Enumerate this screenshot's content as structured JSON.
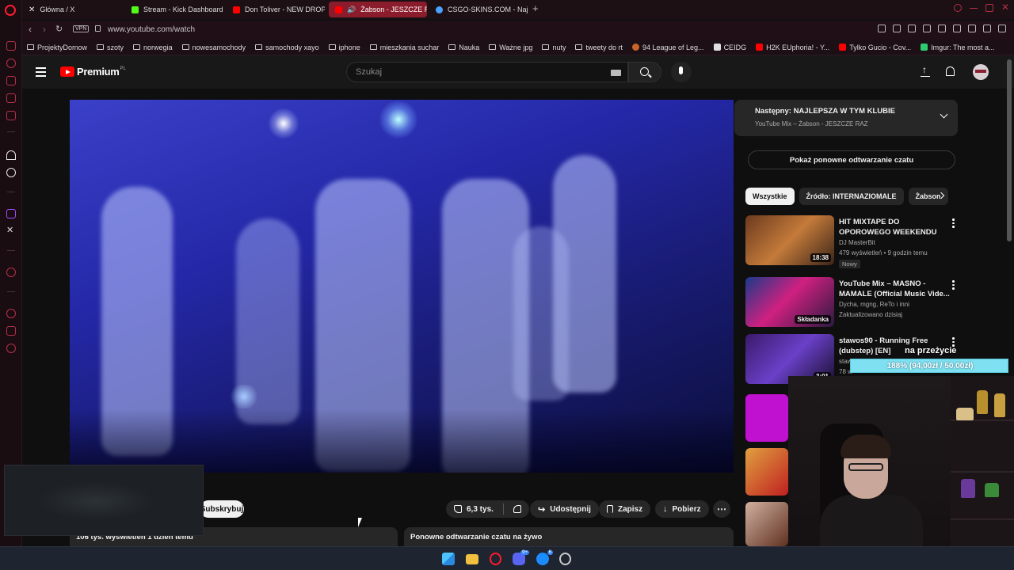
{
  "browser": {
    "tabs": [
      {
        "label": "Główna / X",
        "color": "#e7e7e7"
      },
      {
        "label": "Stream - Kick Dashboard",
        "color": "#53fc18"
      },
      {
        "label": "Don Toliver - NEW DROP",
        "color": "#ff0000"
      },
      {
        "label": "Żabson - JESZCZE RA",
        "color": "#ff0000"
      },
      {
        "label": "CSGO-SKINS.COM - Naj",
        "color": "#4aa3ff"
      }
    ],
    "url": "www.youtube.com/watch",
    "vpn": "VPN",
    "bookmarks": [
      "ProjektyDomow",
      "szoty",
      "norwegia",
      "nowesamochody",
      "samochody xayo",
      "iphone",
      "mieszkania suchar",
      "Nauka",
      "Ważne jpg",
      "nuty",
      "tweety do rt",
      "94 League of Leg...",
      "CEIDG",
      "H2K EUphoria! - Y...",
      "Tylko Gucio - Cov...",
      "Imgur: The most a..."
    ]
  },
  "youtube": {
    "brand": "Premium",
    "region": "PL",
    "search_placeholder": "Szukaj",
    "next": {
      "title": "Następny: NAJLEPSZA W TYM KLUBIE",
      "subtitle": "YouTube Mix – Żabson - JESZCZE RAZ"
    },
    "replay_chat": "Pokaż ponowne odtwarzanie czatu",
    "chips": [
      "Wszystkie",
      "Źródło: INTERNAZIOMALE",
      "Żabson"
    ],
    "recommendations": [
      {
        "title": "HIT MIXTAPE DO OPOROWEGO WEEKENDU",
        "channel": "DJ MasterBit",
        "meta": "479 wyświetleń • 9 godzin temu",
        "badge": "Nowy",
        "duration": "18:38"
      },
      {
        "title": "YouTube Mix – MASNO - MAMALE (Official Music Vide...",
        "channel": "Dycha, mgng, ReTo i inni",
        "meta": "Zaktualizowano dzisiaj",
        "badge": "",
        "duration": "Składanka"
      },
      {
        "title": "stawos90 - Running Free (dubstep) [EN]",
        "channel": "stawos90",
        "meta": "78 w",
        "badge": "",
        "duration": "3:01"
      }
    ],
    "actions": {
      "subscribe": "Subskrybuj",
      "likes": "6,3 tys.",
      "share": "Udostępnij",
      "save": "Zapisz",
      "download": "Pobierz"
    },
    "description": "106 tys. wyświetleń  1 dzień temu",
    "live_chat_replay": "Ponowne odtwarzanie czatu na żywo"
  },
  "overlay": {
    "goal_label": "na przeżycie",
    "goal_progress": "188% (94,00zł / 50,00zł)",
    "goal_fraction": 1.88
  },
  "taskbar": {
    "discord_badge": "9+",
    "messenger_badge": "6"
  }
}
